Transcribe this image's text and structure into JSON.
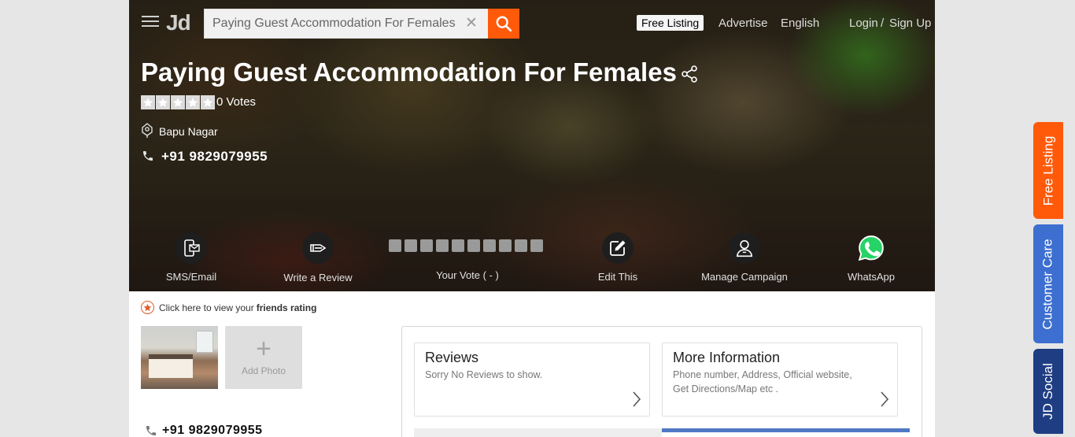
{
  "header": {
    "logo": "Jd",
    "search": {
      "value": "Paying Guest Accommodation For Females",
      "placeholder": ""
    },
    "nav": {
      "free_listing": "Free Listing",
      "advertise": "Advertise",
      "language": "English",
      "login": "Login",
      "separator": "/",
      "signup": "Sign Up"
    }
  },
  "listing": {
    "title": "Paying Guest Accommodation For Females",
    "votes": "0 Votes",
    "location": "Bapu Nagar",
    "phone": "+91 9829079955"
  },
  "actions": [
    {
      "label": "SMS/Email",
      "icon": "sms-email-icon"
    },
    {
      "label": "Write a Review",
      "icon": "pen-icon"
    },
    {
      "label": "Your Vote ( - )",
      "icon": "vote-boxes"
    },
    {
      "label": "Edit This",
      "icon": "edit-icon"
    },
    {
      "label": "Manage Campaign",
      "icon": "user-icon"
    },
    {
      "label": "WhatsApp",
      "icon": "whatsapp-icon"
    }
  ],
  "friends": {
    "prefix": "Click here to view your",
    "bold": "friends rating"
  },
  "photos": {
    "add_label": "Add Photo"
  },
  "contact": {
    "phone": "+91 9829079955"
  },
  "cards": [
    {
      "title": "Reviews",
      "text": "Sorry No Reviews to show."
    },
    {
      "title": "More Information",
      "text": "Phone number, Address, Official website, Get Directions/Map etc ."
    }
  ],
  "side_tabs": [
    {
      "label": "Free Listing",
      "color": "#ff5a0a"
    },
    {
      "label": "Customer Care",
      "color": "#3d6fd0"
    },
    {
      "label": "JD Social",
      "color": "#1f3d82"
    }
  ],
  "colors": {
    "accent": "#ff5a0a",
    "blue": "#4f79c4",
    "whatsapp": "#25d366"
  }
}
